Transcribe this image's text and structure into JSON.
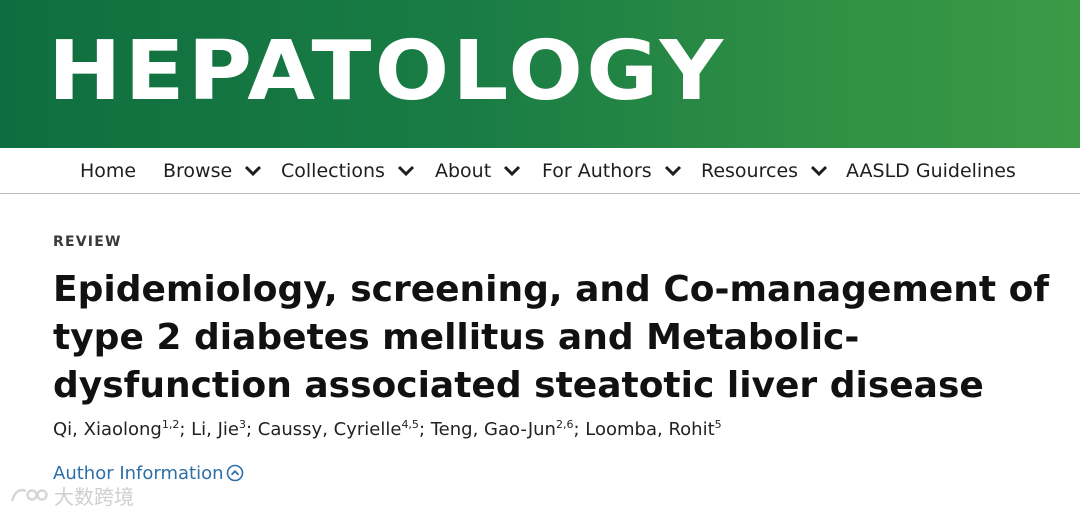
{
  "header": {
    "journal_title": "HEPATOLOGY"
  },
  "nav": {
    "items": [
      {
        "label": "Home"
      },
      {
        "label": "Browse"
      },
      {
        "label": "Collections"
      },
      {
        "label": "About"
      },
      {
        "label": "For Authors"
      },
      {
        "label": "Resources"
      },
      {
        "label": "AASLD Guidelines"
      }
    ],
    "dropdown_icon": "chevron-down-icon"
  },
  "article": {
    "type": "REVIEW",
    "title": "Epidemiology, screening, and Co-management of type 2 diabetes mellitus and Metabolic-dysfunction associated steatotic liver disease",
    "authors": [
      {
        "name": "Qi, Xiaolong",
        "aff": "1,2"
      },
      {
        "name": "Li, Jie",
        "aff": "3"
      },
      {
        "name": "Caussy, Cyrielle",
        "aff": "4,5"
      },
      {
        "name": "Teng, Gao-Jun",
        "aff": "2,6"
      },
      {
        "name": "Loomba, Rohit",
        "aff": "5"
      }
    ],
    "author_info_label": "Author Information",
    "author_info_icon": "circle-chevron-up-icon"
  },
  "watermark": {
    "text": "大数跨境",
    "icon": "watermark-logo-icon"
  },
  "colors": {
    "banner_start": "#0f6e3f",
    "banner_end": "#3a9a46",
    "link": "#2d6fa8"
  }
}
